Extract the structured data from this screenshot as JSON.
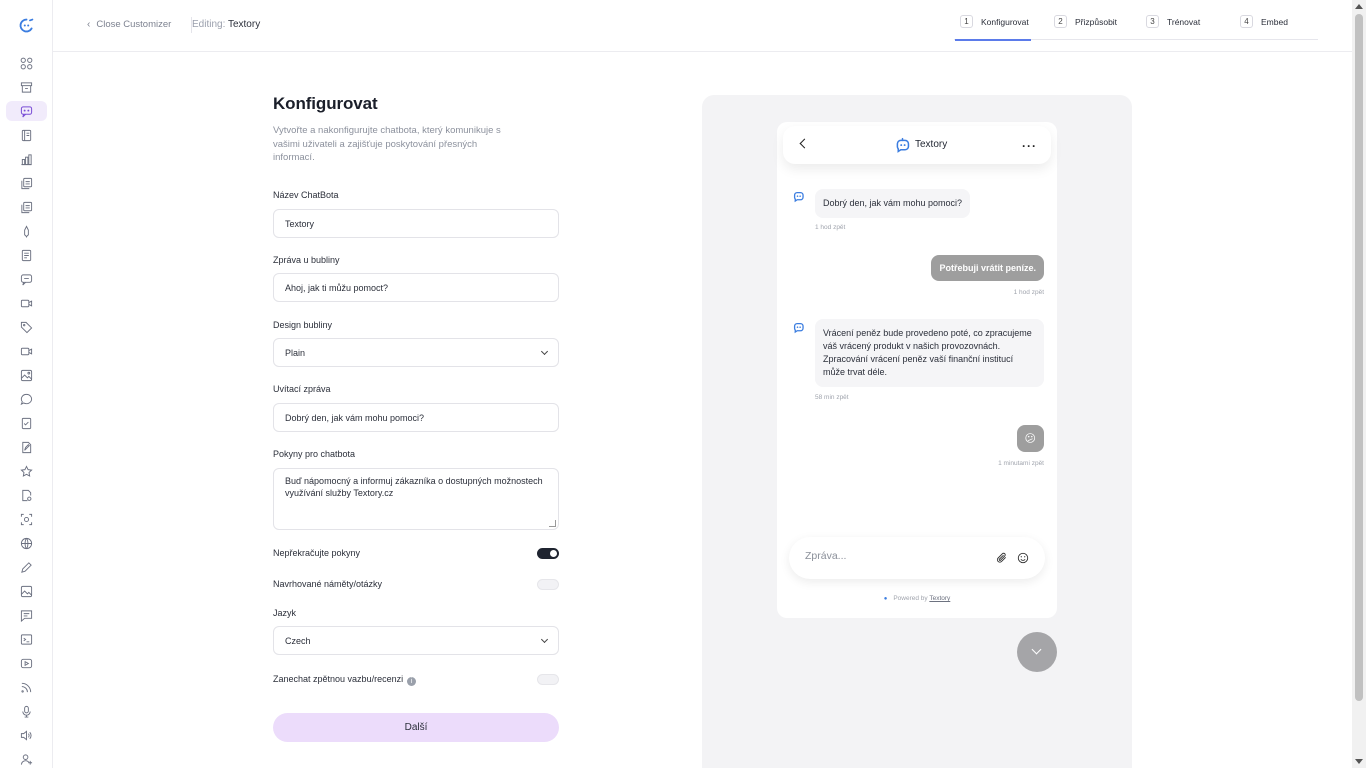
{
  "topbar": {
    "close_label": "Close Customizer",
    "editing_prefix": "Editing:",
    "editing_name": "Textory",
    "steps": [
      {
        "num": "1",
        "label": "Konfigurovat"
      },
      {
        "num": "2",
        "label": "Přizpůsobit"
      },
      {
        "num": "3",
        "label": "Trénovat"
      },
      {
        "num": "4",
        "label": "Embed"
      }
    ]
  },
  "form": {
    "title": "Konfigurovat",
    "description": "Vytvořte a nakonfigurujte chatbota, který komunikuje s vašimi uživateli a zajišťuje poskytování přesných informací.",
    "bot_name_label": "Název ChatBota",
    "bot_name_value": "Textory",
    "bubble_msg_label": "Zpráva u bubliny",
    "bubble_msg_value": "Ahoj, jak ti můžu pomoct?",
    "bubble_design_label": "Design bubliny",
    "bubble_design_value": "Plain",
    "welcome_label": "Uvítací zpráva",
    "welcome_value": "Dobrý den, jak vám mohu pomoci?",
    "instructions_label": "Pokyny pro chatbota",
    "instructions_value": "Buď nápomocný a informuj zákazníka o dostupných možnostech využívání služby Textory.cz",
    "no_exceed_label": "Nepřekračujte pokyny",
    "no_exceed_on": true,
    "suggested_label": "Navrhované náměty/otázky",
    "suggested_on": false,
    "language_label": "Jazyk",
    "language_value": "Czech",
    "feedback_label": "Zanechat zpětnou vazbu/recenzi",
    "feedback_on": false,
    "info_icon": "i",
    "next_label": "Další"
  },
  "preview": {
    "bot_name": "Textory",
    "more_glyph": "···",
    "messages": [
      {
        "from": "bot",
        "text": "Dobrý den, jak vám mohu pomoci?",
        "time": "1 hod zpět"
      },
      {
        "from": "user",
        "text": "Potřebuji vrátit peníze.",
        "time": "1 hod zpět"
      },
      {
        "from": "bot",
        "text": "Vrácení peněz bude provedeno poté, co zpracujeme váš vrácený produkt v našich provozovnách. Zpracování vrácení peněz vaší finanční institucí může trvat déle.",
        "time": "58 min zpět"
      },
      {
        "from": "user",
        "text": "😕",
        "time": "1 minutami zpět"
      }
    ],
    "composer_placeholder": "Zpráva...",
    "powered_prefix": "Powered by",
    "powered_brand": "Textory"
  },
  "colors": {
    "accent": "#5b7bea",
    "brand_icon": "#3b7de0",
    "next_button": "#ecdcfb",
    "active_rail": "#f1ebfb",
    "user_bubble": "#9e9e9e"
  },
  "rail_icons": [
    "grid-icon",
    "archive-icon",
    "chat-icon",
    "book-icon",
    "bar-chart-icon",
    "copy-icon",
    "copy-icon",
    "pen-icon",
    "document-icon",
    "message-icon",
    "video-icon",
    "tag-icon",
    "camera-icon",
    "image-icon",
    "comment-icon",
    "file-check-icon",
    "file-edit-icon",
    "star-icon",
    "file-settings-icon",
    "scan-icon",
    "globe-icon",
    "pencil-icon",
    "image-icon",
    "message-square-icon",
    "terminal-icon",
    "play-icon",
    "rss-icon",
    "mic-icon",
    "speaker-icon",
    "add-user-icon"
  ]
}
